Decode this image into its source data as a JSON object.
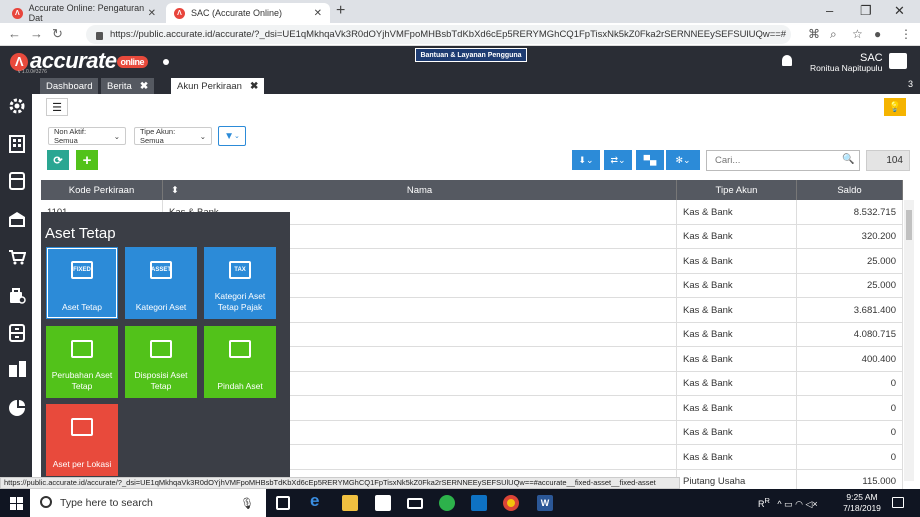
{
  "browser": {
    "tabs": [
      {
        "title": "Accurate Online: Pengaturan Dat"
      },
      {
        "title": "SAC (Accurate Online)"
      }
    ],
    "url": "https://public.accurate.id/accurate/?_dsi=UE1qMkhqaVk3R0dOYjhVMFpoMHBsbTdKbXd6cEp5RERYMGhCQ1FpTisxNk5kZ0Fka2rSERNNEEySEFSUlUQw==#"
  },
  "app": {
    "logo": "accurate",
    "logo_badge": "online",
    "version": "v 1.0.0#3276",
    "help_button": "Bantuan & Layanan Pengguna",
    "company": "SAC",
    "user": "Ronitua Napitupulu"
  },
  "app_tabs": [
    {
      "label": "Dashboard"
    },
    {
      "label": "Berita"
    },
    {
      "label": "Akun Perkiraan"
    }
  ],
  "tab_count": "3",
  "filters": {
    "non_aktif": "Non Aktif: Semua",
    "tipe_akun": "Tipe Akun: Semua"
  },
  "search": {
    "placeholder": "Cari..."
  },
  "record_count": "104",
  "table": {
    "headers": {
      "kode": "Kode Perkiraan",
      "nama": "Nama",
      "tipe": "Tipe Akun",
      "saldo": "Saldo"
    },
    "rows": [
      {
        "kode": "1101",
        "nama": "Kas & Bank",
        "tipe": "Kas & Bank",
        "saldo": "8.532.715"
      },
      {
        "kode": "",
        "nama": "",
        "tipe": "Kas & Bank",
        "saldo": "320.200"
      },
      {
        "kode": "",
        "nama": "",
        "tipe": "Kas & Bank",
        "saldo": "25.000"
      },
      {
        "kode": "",
        "nama": "",
        "tipe": "Kas & Bank",
        "saldo": "25.000"
      },
      {
        "kode": "",
        "nama": "",
        "tipe": "Kas & Bank",
        "saldo": "3.681.400"
      },
      {
        "kode": "",
        "nama": "",
        "tipe": "Kas & Bank",
        "saldo": "4.080.715"
      },
      {
        "kode": "",
        "nama": "",
        "tipe": "Kas & Bank",
        "saldo": "400.400"
      },
      {
        "kode": "",
        "nama": "",
        "tipe": "Kas & Bank",
        "saldo": "0"
      },
      {
        "kode": "",
        "nama": "",
        "tipe": "Kas & Bank",
        "saldo": "0"
      },
      {
        "kode": "",
        "nama": "",
        "tipe": "Kas & Bank",
        "saldo": "0"
      },
      {
        "kode": "",
        "nama": "",
        "tipe": "Kas & Bank",
        "saldo": "0"
      },
      {
        "kode": "",
        "nama": "",
        "tipe": "Piutang Usaha",
        "saldo": "115.000"
      }
    ]
  },
  "overlay": {
    "title": "Aset Tetap",
    "tiles": [
      {
        "label": "Aset Tetap",
        "icon_text": "FIXED",
        "icon": "fixed-asset-icon",
        "color": "#2c8bd8"
      },
      {
        "label": "Kategori Aset",
        "icon_text": "ASSET",
        "icon": "asset-category-icon",
        "color": "#2c8bd8"
      },
      {
        "label": "Kategori Aset Tetap Pajak",
        "icon_text": "TAX",
        "icon": "tax-category-icon",
        "color": "#2c8bd8"
      },
      {
        "label": "Perubahan Aset Tetap",
        "icon_text": "",
        "icon": "asset-change-icon",
        "color": "#52c21a"
      },
      {
        "label": "Disposisi Aset Tetap",
        "icon_text": "",
        "icon": "asset-disposal-icon",
        "color": "#52c21a"
      },
      {
        "label": "Pindah Aset",
        "icon_text": "",
        "icon": "asset-move-icon",
        "color": "#52c21a"
      },
      {
        "label": "Aset per Lokasi",
        "icon_text": "",
        "icon": "asset-location-icon",
        "color": "#e84a3c"
      }
    ]
  },
  "status_url": "https://public.accurate.id/accurate/?_dsi=UE1qMkhqaVk3R0dOYjhVMFpoMHBsbTdKbXd6cEp5RERYMGhCQ1FpTisxNk5kZ0Fka2rSERNNEEySEFSUlUQw==#accurate__fixed-asset__fixed-asset",
  "taskbar": {
    "search_placeholder": "Type here to search",
    "time": "9:25 AM",
    "date": "7/18/2019"
  }
}
